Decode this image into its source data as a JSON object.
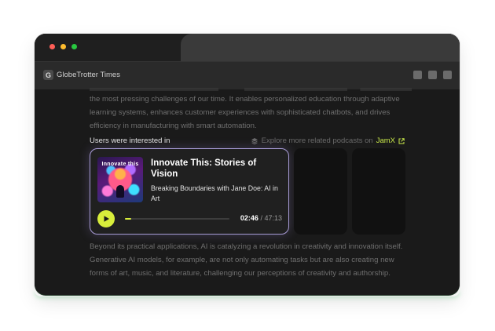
{
  "window": {
    "site_title": "GlobeTrotter Times",
    "site_icon_letter": "G",
    "traffic_lights": [
      "#ff5f57",
      "#febc2e",
      "#28c840"
    ]
  },
  "article": {
    "para_top": "the most pressing challenges of our time. It enables personalized education through adaptive learning systems, enhances customer experiences with sophisticated chatbots, and drives efficiency in manufacturing with smart automation.",
    "para_bottom": "Beyond its practical applications, AI is catalyzing a revolution in creativity and innovation itself. Generative AI models, for example, are not only automating tasks but are also creating new forms of art, music, and literature, challenging our perceptions of creativity and authorship."
  },
  "recommendations": {
    "label": "Users were interested in",
    "explore_text": "Explore more related podcasts on",
    "explore_brand": "JamX",
    "explore_icon": "layers-icon",
    "external_icon": "external-link-icon"
  },
  "podcast": {
    "cover_text": "Innovate this",
    "title": "Innovate This: Stories of Vision",
    "episode": "Breaking Boundaries with Jane Doe: AI in Art",
    "current_time": "02:46",
    "separator": " / ",
    "total_time": "47:13",
    "progress_fraction": 0.059,
    "accent_color": "#d8ee3b",
    "border_color": "#a79bd6",
    "play_icon": "play-icon"
  }
}
